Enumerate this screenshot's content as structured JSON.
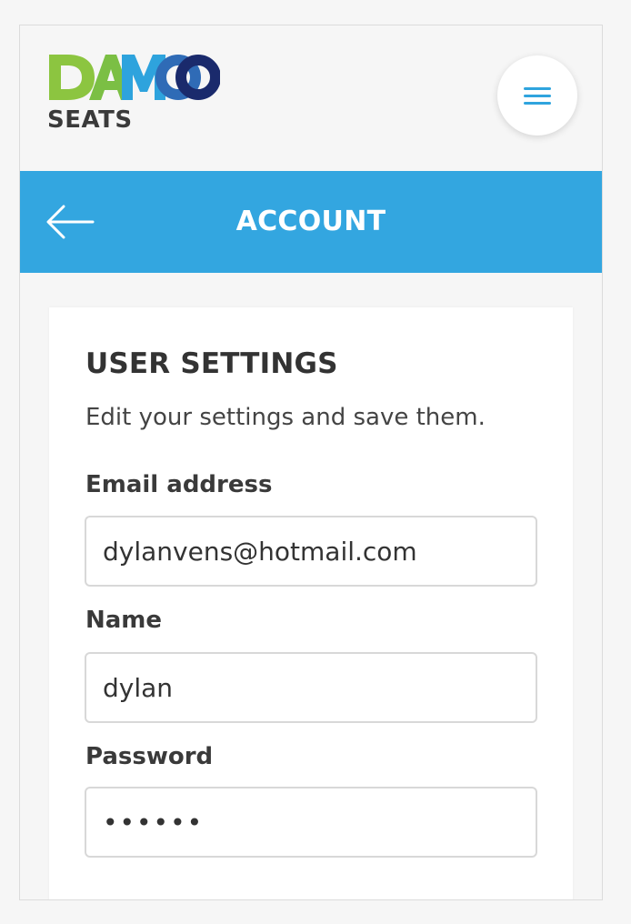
{
  "brand": {
    "logo_text": "DAMOO",
    "sub_text": "SEATS",
    "colors": {
      "green": "#8cc540",
      "light_blue": "#2ea3dd",
      "dark_blue": "#1a2a6c"
    }
  },
  "header": {
    "menu_icon": "hamburger-icon",
    "accent": "#2fa4de"
  },
  "titlebar": {
    "title": "ACCOUNT",
    "back_icon": "arrow-left-icon",
    "background": "#33a6e0"
  },
  "settings": {
    "title": "USER SETTINGS",
    "description": "Edit your settings and save them.",
    "fields": [
      {
        "label": "Email address",
        "value": "dylanvens@hotmail.com",
        "type": "email"
      },
      {
        "label": "Name",
        "value": "dylan",
        "type": "text"
      },
      {
        "label": "Password",
        "value": "••••••",
        "type": "password"
      }
    ]
  }
}
